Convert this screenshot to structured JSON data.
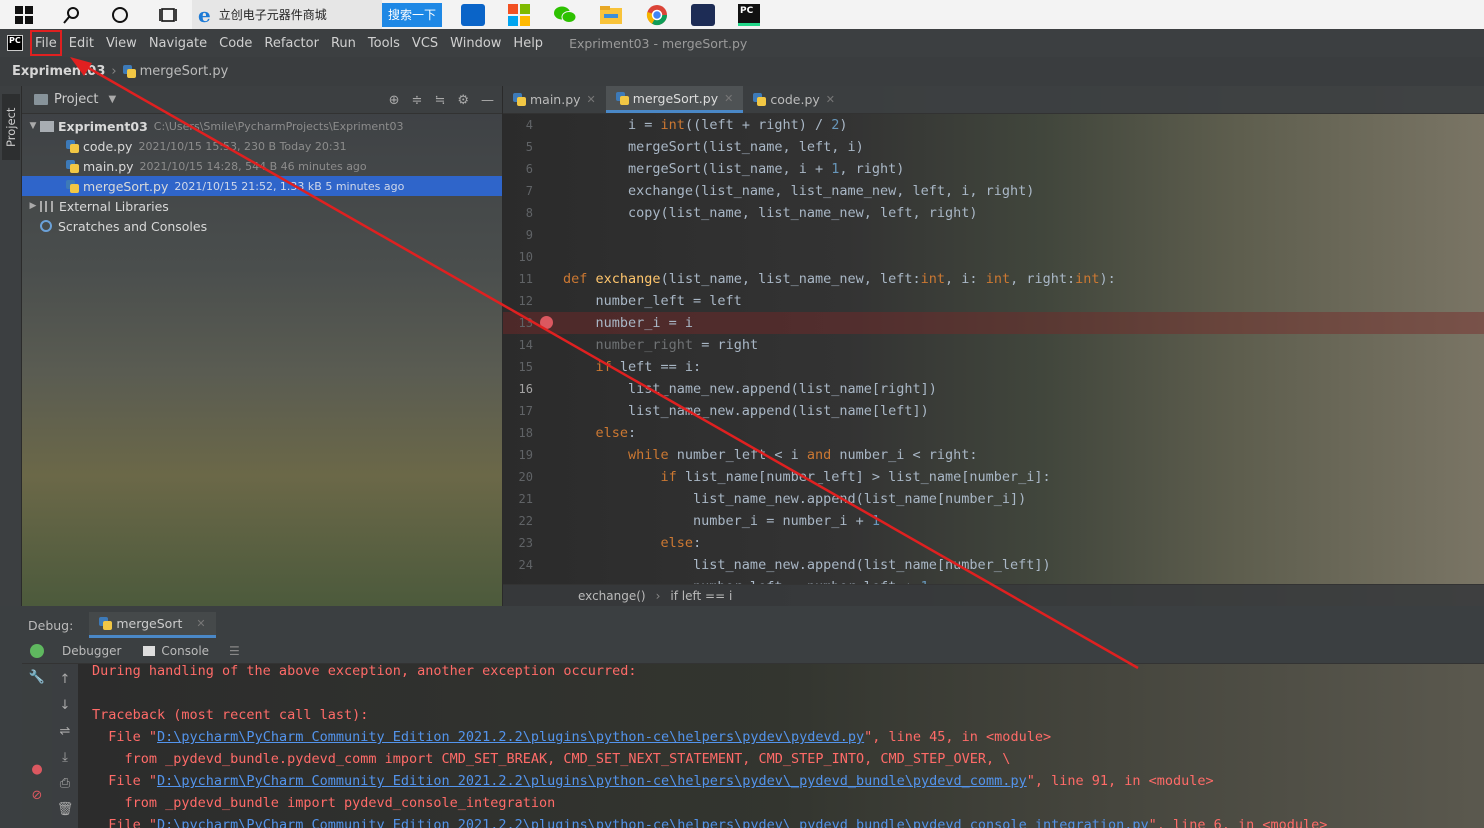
{
  "taskbar": {
    "browser_tab": "立创电子元器件商城",
    "search_button": "搜索一下",
    "pycharm_logo": "PC"
  },
  "menubar": {
    "logo": "PC",
    "items": [
      "File",
      "Edit",
      "View",
      "Navigate",
      "Code",
      "Refactor",
      "Run",
      "Tools",
      "VCS",
      "Window",
      "Help"
    ],
    "window_title": "Expriment03 - mergeSort.py"
  },
  "navbar": {
    "project": "Expriment03",
    "file": "mergeSort.py"
  },
  "left_stripe": {
    "project_tab": "Project"
  },
  "project_panel": {
    "title": "Project",
    "root": {
      "name": "Expriment03",
      "path": "C:\\Users\\Smile\\PycharmProjects\\Expriment03"
    },
    "files": [
      {
        "name": "code.py",
        "meta": "2021/10/15 15:53, 230 B Today 20:31"
      },
      {
        "name": "main.py",
        "meta": "2021/10/15 14:28, 544 B 46 minutes ago"
      },
      {
        "name": "mergeSort.py",
        "meta": "2021/10/15 21:52, 1.33 kB 5 minutes ago"
      }
    ],
    "external": "External Libraries",
    "scratches": "Scratches and Consoles"
  },
  "editor": {
    "tabs": [
      "main.py",
      "mergeSort.py",
      "code.py"
    ],
    "line_numbers": [
      "4",
      "5",
      "6",
      "7",
      "8",
      "9",
      "10",
      "11",
      "12",
      "13",
      "14",
      "15",
      "16",
      "17",
      "18",
      "19",
      "20",
      "21",
      "22",
      "23",
      "24"
    ],
    "breadcrumb": [
      "exchange()",
      "if left == i"
    ]
  },
  "debug": {
    "label": "Debug:",
    "config": "mergeSort",
    "tabs": [
      "Debugger",
      "Console"
    ]
  },
  "console": {
    "line1": "During handling of the above exception, another exception occurred:",
    "line2": "Traceback (most recent call last):",
    "f1_pre": "  File \"",
    "f1_link": "D:\\pycharm\\PyCharm Community Edition 2021.2.2\\plugins\\python-ce\\helpers\\pydev\\pydevd.py",
    "f1_post": "\", line 45, in <module>",
    "f1_code": "    from _pydevd_bundle.pydevd_comm import CMD_SET_BREAK, CMD_SET_NEXT_STATEMENT, CMD_STEP_INTO, CMD_STEP_OVER, \\",
    "f2_pre": "  File \"",
    "f2_link": "D:\\pycharm\\PyCharm Community Edition 2021.2.2\\plugins\\python-ce\\helpers\\pydev\\_pydevd_bundle\\pydevd_comm.py",
    "f2_post": "\", line 91, in <module>",
    "f2_code": "    from _pydevd_bundle import pydevd_console_integration",
    "f3_pre": "  File \"",
    "f3_link": "D:\\pycharm\\PyCharm Community Edition 2021.2.2\\plugins\\python-ce\\helpers\\pydev\\_pydevd_bundle\\pydevd_console_integration.py",
    "f3_post": "\", line 6, in <module>"
  },
  "colors": {
    "annotation": "#e02020",
    "selection": "#2f65ca",
    "error_text": "#ff6b68",
    "link": "#5394ec"
  }
}
